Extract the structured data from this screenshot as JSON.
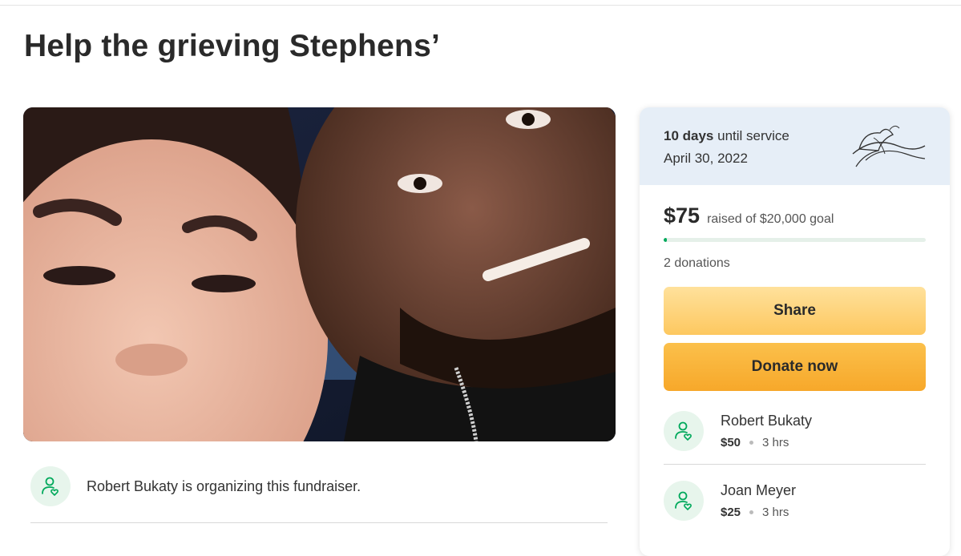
{
  "page": {
    "title": "Help the grieving Stephens’"
  },
  "photo": {
    "icon": "fundraiser-photo"
  },
  "organizer": {
    "text": "Robert Bukaty is organizing this fundraiser.",
    "icon": "user-heart-icon"
  },
  "service": {
    "days": "10 days",
    "days_suffix": "until service",
    "date": "April 30, 2022",
    "icon": "lily-flower-icon"
  },
  "funding": {
    "raised": "$75",
    "goal_text": "raised of $20,000 goal",
    "progress_fraction": 0.00375,
    "donations": "2 donations"
  },
  "buttons": {
    "share": "Share",
    "donate": "Donate now"
  },
  "donors": [
    {
      "name": "Robert Bukaty",
      "amount": "$50",
      "time": "3 hrs"
    },
    {
      "name": "Joan Meyer",
      "amount": "$25",
      "time": "3 hrs"
    }
  ],
  "colors": {
    "accent_green": "#02a95c",
    "share_button": "#fdc860",
    "donate_button": "#f7a82a",
    "banner": "#e6eef7"
  }
}
